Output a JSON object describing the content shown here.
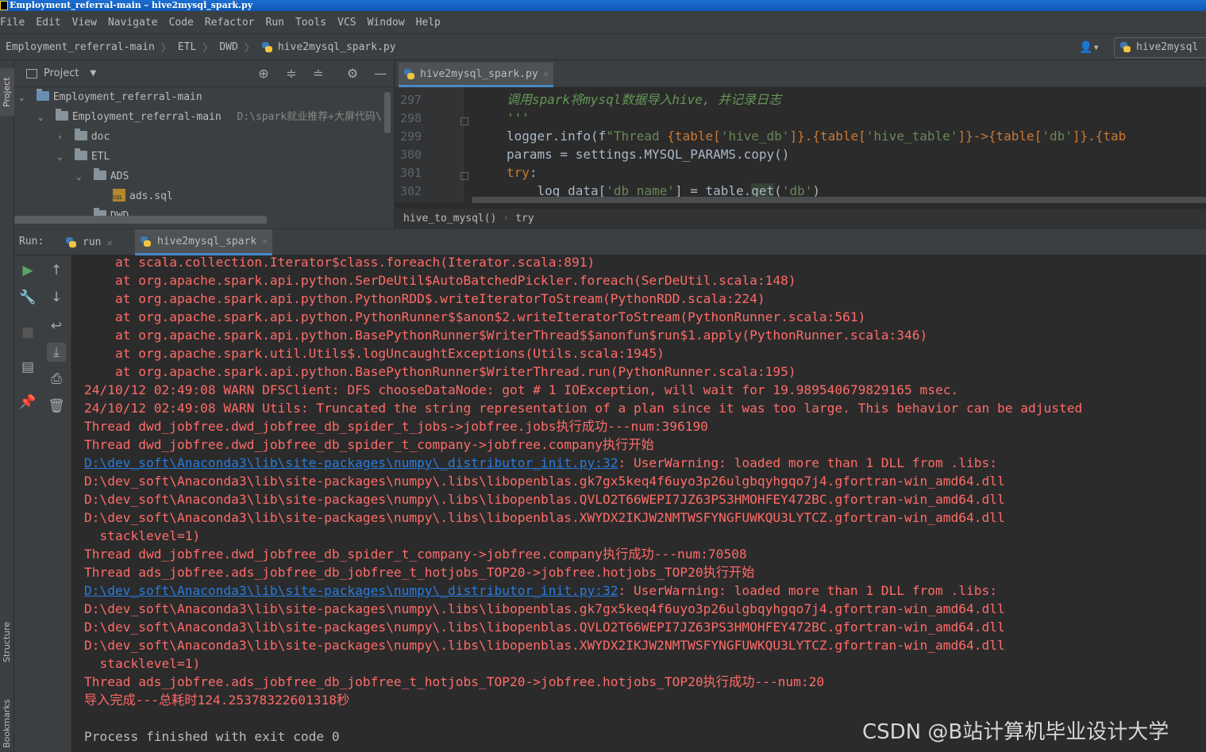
{
  "window": {
    "title": "Employment_referral-main – hive2mysql_spark.py"
  },
  "menu": [
    "File",
    "Edit",
    "View",
    "Navigate",
    "Code",
    "Refactor",
    "Run",
    "Tools",
    "VCS",
    "Window",
    "Help"
  ],
  "breadcrumb": {
    "project": "Employment_referral-main",
    "folder1": "ETL",
    "folder2": "DWD",
    "file": "hive2mysql_spark.py"
  },
  "run_config": {
    "label": "hive2mysql"
  },
  "side_tabs": {
    "project": "Project",
    "structure": "Structure",
    "bookmarks": "Bookmarks"
  },
  "project_panel": {
    "title": "Project",
    "tree": [
      {
        "label": "Employment_referral-main",
        "type": "module"
      },
      {
        "label": "Employment_referral-main",
        "hint": "D:\\spark就业推荐+大屏代码\\",
        "type": "folder"
      },
      {
        "label": "doc",
        "type": "folder"
      },
      {
        "label": "ETL",
        "type": "folder"
      },
      {
        "label": "ADS",
        "type": "folder"
      },
      {
        "label": "ads.sql",
        "type": "sql"
      },
      {
        "label": "DWD",
        "type": "folder"
      }
    ]
  },
  "editor": {
    "tab": "hive2mysql_spark.py",
    "line_numbers": [
      "297",
      "298",
      "299",
      "300",
      "301",
      "302"
    ],
    "code": {
      "l297": "调用spark将mysql数据导入hive, 并记录日志",
      "l298": "'''",
      "l299a": "logger.info(f",
      "l299b": "\"Thread ",
      "l299c": "{table[",
      "l299d": "'hive_db'",
      "l299e": "]}.{table[",
      "l299f": "'hive_table'",
      "l299g": "]}->{table[",
      "l299h": "'db'",
      "l299i": "]}.{tab",
      "l300": "params = settings.MYSQL_PARAMS.copy()",
      "l301": "try",
      "l302a": "    log_data[",
      "l302b": "'db_name'",
      "l302c": "] = table.",
      "l302d": "get",
      "l302e": "(",
      "l302f": "'db'",
      "l302g": ")"
    },
    "crumbs": {
      "fn": "hive_to_mysql()",
      "block": "try"
    }
  },
  "run_panel": {
    "label": "Run:",
    "tabs": [
      {
        "label": "run"
      },
      {
        "label": "hive2mysql_spark"
      }
    ]
  },
  "console": {
    "lines": [
      "    at scala.collection.Iterator$class.foreach(Iterator.scala:891)",
      "    at org.apache.spark.api.python.SerDeUtil$AutoBatchedPickler.foreach(SerDeUtil.scala:148)",
      "    at org.apache.spark.api.python.PythonRDD$.writeIteratorToStream(PythonRDD.scala:224)",
      "    at org.apache.spark.api.python.PythonRunner$$anon$2.writeIteratorToStream(PythonRunner.scala:561)",
      "    at org.apache.spark.api.python.BasePythonRunner$WriterThread$$anonfun$run$1.apply(PythonRunner.scala:346)",
      "    at org.apache.spark.util.Utils$.logUncaughtExceptions(Utils.scala:1945)",
      "    at org.apache.spark.api.python.BasePythonRunner$WriterThread.run(PythonRunner.scala:195)",
      "24/10/12 02:49:08 WARN DFSClient: DFS chooseDataNode: got # 1 IOException, will wait for 19.989540679829165 msec.",
      "24/10/12 02:49:08 WARN Utils: Truncated the string representation of a plan since it was too large. This behavior can be adjusted",
      "Thread dwd_jobfree.dwd_jobfree_db_spider_t_jobs->jobfree.jobs执行成功---num:396190",
      "Thread dwd_jobfree.dwd_jobfree_db_spider_t_company->jobfree.company执行开始",
      "D:\\dev_soft\\Anaconda3\\lib\\site-packages\\numpy\\_distributor_init.py:32",
      ": UserWarning: loaded more than 1 DLL from .libs:",
      "D:\\dev_soft\\Anaconda3\\lib\\site-packages\\numpy\\.libs\\libopenblas.gk7gx5keq4f6uyo3p26ulgbqyhgqo7j4.gfortran-win_amd64.dll",
      "D:\\dev_soft\\Anaconda3\\lib\\site-packages\\numpy\\.libs\\libopenblas.QVLO2T66WEPI7JZ63PS3HMOHFEY472BC.gfortran-win_amd64.dll",
      "D:\\dev_soft\\Anaconda3\\lib\\site-packages\\numpy\\.libs\\libopenblas.XWYDX2IKJW2NMTWSFYNGFUWKQU3LYTCZ.gfortran-win_amd64.dll",
      "  stacklevel=1)",
      "Thread dwd_jobfree.dwd_jobfree_db_spider_t_company->jobfree.company执行成功---num:70508",
      "Thread ads_jobfree.ads_jobfree_db_jobfree_t_hotjobs_TOP20->jobfree.hotjobs_TOP20执行开始",
      "D:\\dev_soft\\Anaconda3\\lib\\site-packages\\numpy\\_distributor_init.py:32",
      ": UserWarning: loaded more than 1 DLL from .libs:",
      "D:\\dev_soft\\Anaconda3\\lib\\site-packages\\numpy\\.libs\\libopenblas.gk7gx5keq4f6uyo3p26ulgbqyhgqo7j4.gfortran-win_amd64.dll",
      "D:\\dev_soft\\Anaconda3\\lib\\site-packages\\numpy\\.libs\\libopenblas.QVLO2T66WEPI7JZ63PS3HMOHFEY472BC.gfortran-win_amd64.dll",
      "D:\\dev_soft\\Anaconda3\\lib\\site-packages\\numpy\\.libs\\libopenblas.XWYDX2IKJW2NMTWSFYNGFUWKQU3LYTCZ.gfortran-win_amd64.dll",
      "  stacklevel=1)",
      "Thread ads_jobfree.ads_jobfree_db_jobfree_t_hotjobs_TOP20->jobfree.hotjobs_TOP20执行成功---num:20",
      "导入完成---总耗时124.25378322601318秒",
      "Process finished with exit code 0"
    ]
  },
  "watermark": "CSDN @B站计算机毕业设计大学",
  "icons": {
    "run": "play-icon",
    "up": "arrow-up-icon",
    "down": "arrow-down-icon",
    "wrench": "wrench-icon",
    "stop": "stop-icon",
    "wrap": "soft-wrap-icon",
    "scroll": "scroll-to-end-icon",
    "layout": "layout-icon",
    "print": "print-icon",
    "pin": "pin-icon",
    "trash": "trash-icon",
    "settings": "gear-icon",
    "target": "locate-icon"
  },
  "colors": {
    "error_text": "#ff6b68",
    "link": "#287bde",
    "normal_text": "#bbbbbb",
    "accent_tab": "#4a88c7"
  }
}
